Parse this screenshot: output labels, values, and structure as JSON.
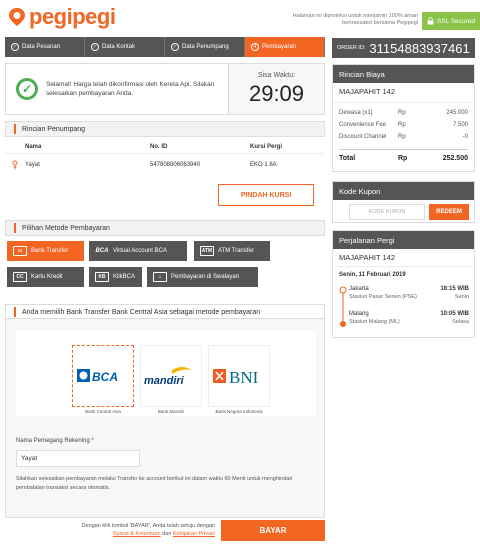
{
  "header": {
    "brand": "pegipegi",
    "guarantee": "Halaman ini diproteksi untuk menjamin 100% aman bertransaksi bersama Pegipegi",
    "ssl_label": "SSL Secured"
  },
  "steps": [
    {
      "label": "Data Pesanan",
      "done": true
    },
    {
      "label": "Data Kontak",
      "done": true
    },
    {
      "label": "Data Penumpang",
      "done": true
    },
    {
      "label": "Pembayaran",
      "number": "4"
    }
  ],
  "confirm": {
    "message": "Selamat! Harga telah dikonfirmasi oleh Kereta Api. Silakan selesaikan pembayaran Anda.",
    "wait_label": "Sisa Waktu:",
    "timer": "29:09"
  },
  "order": {
    "label": "ORDER ID:",
    "id": "31154883937461"
  },
  "price": {
    "title": "Rincian Biaya",
    "train": "MAJAPAHIT 142",
    "rows": [
      {
        "label": "Dewasa (x1)",
        "currency": "Rp",
        "amount": "245.000"
      },
      {
        "label": "Convenience Fee",
        "currency": "Rp",
        "amount": "7.500"
      },
      {
        "label": "Discount Channel",
        "currency": "Rp",
        "amount": "-0"
      }
    ],
    "total_label": "Total",
    "total_currency": "Rp",
    "total_amount": "252.500"
  },
  "passenger": {
    "title": "Rincian Penumpang",
    "headers": [
      "Nama",
      "No. ID",
      "Kursi Pergi"
    ],
    "rows": [
      {
        "name": "Yayat",
        "id": "547808006063940",
        "seat": "EKO 1 8A"
      }
    ],
    "change_seat": "PINDAH KURSI"
  },
  "coupon": {
    "title": "Kode Kupon",
    "placeholder": "KODE KUPON",
    "redeem": "REDEEM"
  },
  "trip": {
    "title": "Perjalanan Pergi",
    "train": "MAJAPAHIT 142",
    "date": "Senin, 11 Februari 2019",
    "depart_city": "Jakarta",
    "depart_time": "18:15 WIB",
    "depart_station": "Stasiun Pasar Senen (PSE)",
    "depart_day": "Senin",
    "arrive_city": "Malang",
    "arrive_time": "10:05 WIB",
    "arrive_station": "Stasiun Malang (ML)",
    "arrive_day": "Selasa"
  },
  "methods": {
    "title": "Pilihan Metode Pembayaran",
    "items": [
      "Bank Transfer",
      "Virtual Account BCA",
      "ATM Transfer",
      "Kartu Kredit",
      "KlikBCA",
      "Pembayaran di Swalayan"
    ],
    "icons": [
      "BCA",
      "ATM",
      "CC",
      "KB"
    ]
  },
  "payment": {
    "notice": "Anda memilih Bank Transfer Bank Central Asia sebagai metode pembayaran",
    "banks": [
      {
        "logo": "BCA",
        "name": "Bank Central Asia"
      },
      {
        "logo": "mandiri",
        "name": "Bank Mandiri"
      },
      {
        "logo": "BNI",
        "name": "Bank Negara Indonesia"
      }
    ],
    "holder_label": "Nama Pemegang Rekening *",
    "holder_value": "Yayat",
    "instruction": "Silahkan selesaikan pembayaran melalui Transfer ke account berikut ini dalam waktu 60 Menit untuk menghindari pembatalan transaksi secara otomatis."
  },
  "footer": {
    "agree_text": "Dengan klik tombol 'BAYAR', Anda telah setuju dengan",
    "terms": "Syarat & Ketentuan",
    "and": "dan",
    "privacy": "Kebijakan Privasi",
    "pay": "BAYAR"
  },
  "colors": {
    "accent": "#f26522",
    "dark": "#555555",
    "success": "#4caf50",
    "ssl": "#8bc34a"
  }
}
